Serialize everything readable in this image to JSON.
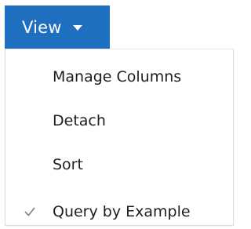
{
  "toolbar": {
    "view_label": "View",
    "view_icon": "caret-down-icon",
    "accent_color": "#1f6fc0"
  },
  "menu": {
    "items": [
      {
        "label": "Manage Columns",
        "checked": false
      },
      {
        "label": "Detach",
        "checked": false
      },
      {
        "label": "Sort",
        "checked": false
      },
      {
        "label": "Query by Example",
        "checked": true,
        "icon": "checkmark-icon"
      }
    ]
  }
}
